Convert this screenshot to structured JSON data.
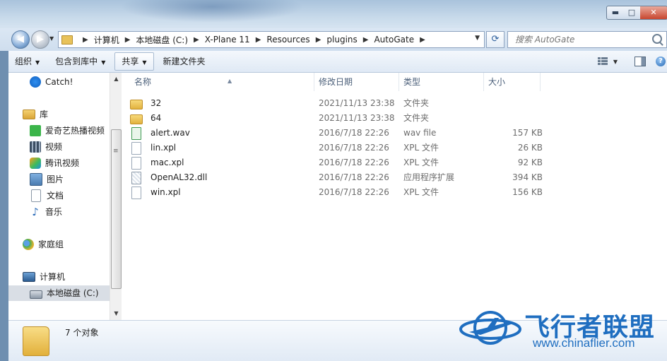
{
  "window": {
    "controls": {
      "minimize": "▬",
      "maximize": "□",
      "close": "✕"
    }
  },
  "address": {
    "crumbs": [
      "计算机",
      "本地磁盘 (C:)",
      "X-Plane 11",
      "Resources",
      "plugins",
      "AutoGate"
    ],
    "search_placeholder": "搜索 AutoGate"
  },
  "toolbar": {
    "organize": "组织",
    "include_in_library": "包含到库中",
    "share": "共享",
    "new_folder": "新建文件夹"
  },
  "nav": {
    "items": [
      {
        "label": "Catch!",
        "icon": "catch-icon"
      },
      {
        "label": "库",
        "icon": "library-icon"
      },
      {
        "label": "爱奇艺热播视频",
        "icon": "iqiyi-icon"
      },
      {
        "label": "视频",
        "icon": "video-icon"
      },
      {
        "label": "腾讯视频",
        "icon": "tencent-video-icon"
      },
      {
        "label": "图片",
        "icon": "pictures-icon"
      },
      {
        "label": "文档",
        "icon": "documents-icon"
      },
      {
        "label": "音乐",
        "icon": "music-icon"
      },
      {
        "label": "家庭组",
        "icon": "homegroup-icon"
      },
      {
        "label": "计算机",
        "icon": "computer-icon"
      },
      {
        "label": "本地磁盘 (C:)",
        "icon": "drive-icon"
      }
    ]
  },
  "columns": {
    "name": "名称",
    "modified": "修改日期",
    "type": "类型",
    "size": "大小"
  },
  "files": [
    {
      "name": "32",
      "modified": "2021/11/13 23:38",
      "type": "文件夹",
      "size": "",
      "icon": "folder"
    },
    {
      "name": "64",
      "modified": "2021/11/13 23:38",
      "type": "文件夹",
      "size": "",
      "icon": "folder"
    },
    {
      "name": "alert.wav",
      "modified": "2016/7/18 22:26",
      "type": "wav file",
      "size": "157 KB",
      "icon": "wav"
    },
    {
      "name": "lin.xpl",
      "modified": "2016/7/18 22:26",
      "type": "XPL 文件",
      "size": "26 KB",
      "icon": "doc"
    },
    {
      "name": "mac.xpl",
      "modified": "2016/7/18 22:26",
      "type": "XPL 文件",
      "size": "92 KB",
      "icon": "doc"
    },
    {
      "name": "OpenAL32.dll",
      "modified": "2016/7/18 22:26",
      "type": "应用程序扩展",
      "size": "394 KB",
      "icon": "dll"
    },
    {
      "name": "win.xpl",
      "modified": "2016/7/18 22:26",
      "type": "XPL 文件",
      "size": "156 KB",
      "icon": "doc"
    }
  ],
  "status": {
    "item_count": "7 个对象"
  },
  "watermark": {
    "title": "飞行者联盟",
    "url": "www.chinaflier.com"
  },
  "colors": {
    "accent": "#1f6ec0",
    "selection": "#d9dee5"
  }
}
